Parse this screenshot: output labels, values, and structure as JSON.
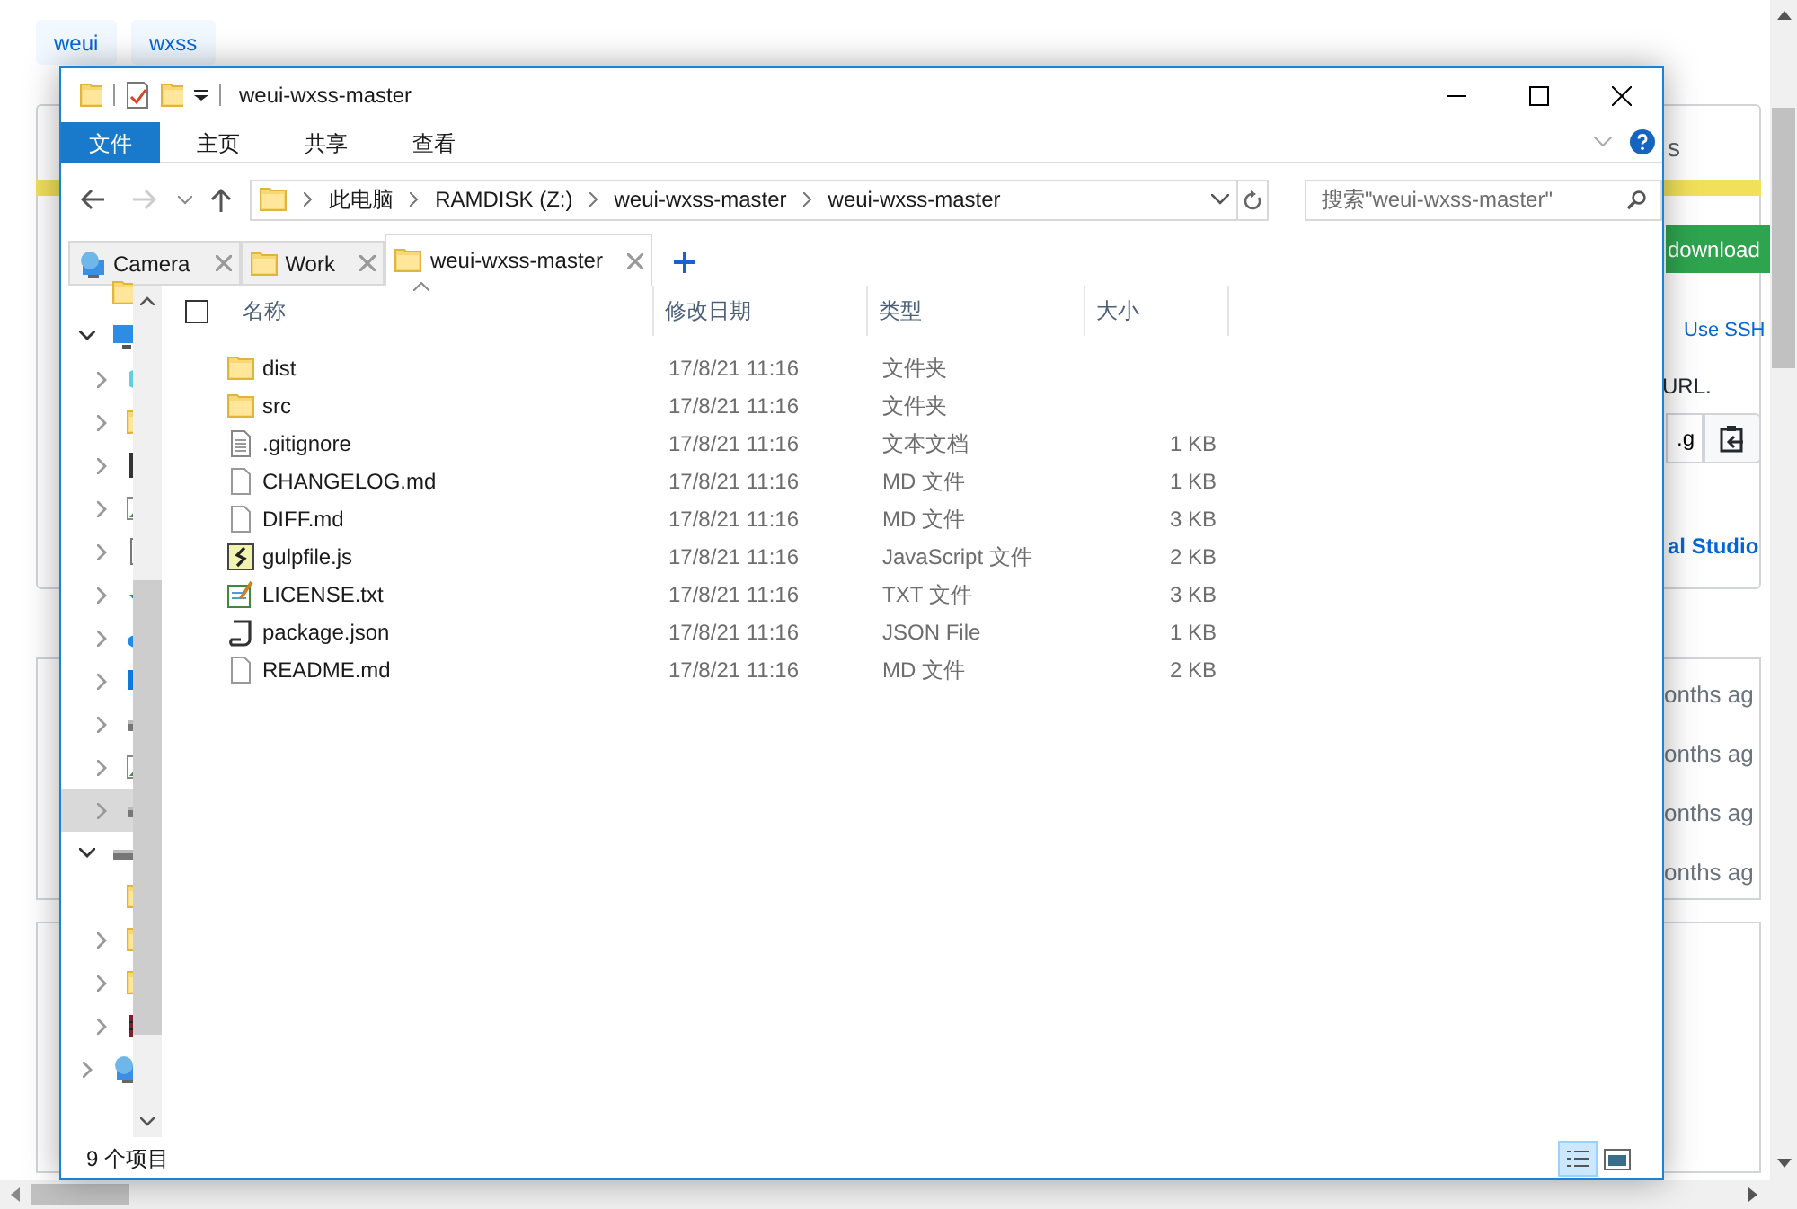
{
  "background_page": {
    "tags": [
      "weui",
      "wxss"
    ],
    "cut_text": "s",
    "download_button": "download",
    "ssh_link": "Use SSH",
    "hint": "URL.",
    "url_field": ".g",
    "studio_link": "al Studio",
    "commit_times": [
      "onths ag",
      "onths ag",
      "onths ag",
      "onths ag"
    ]
  },
  "window": {
    "title": "weui-wxss-master"
  },
  "ribbon_tabs": [
    {
      "label": "文件",
      "selected": true
    },
    {
      "label": "主页",
      "selected": false
    },
    {
      "label": "共享",
      "selected": false
    },
    {
      "label": "查看",
      "selected": false
    }
  ],
  "address": {
    "crumbs": [
      "此电脑",
      "RAMDISK (Z:)",
      "weui-wxss-master",
      "weui-wxss-master"
    ]
  },
  "search": {
    "placeholder": "搜索\"weui-wxss-master\""
  },
  "tabs": [
    {
      "label": "Camera",
      "kind": "network",
      "selected": false
    },
    {
      "label": "Work",
      "kind": "folder",
      "selected": false
    },
    {
      "label": "weui-wxss-master",
      "kind": "folder",
      "selected": true
    }
  ],
  "select_all": {
    "checked": false
  },
  "columns": [
    "名称",
    "修改日期",
    "类型",
    "大小"
  ],
  "files": [
    {
      "name": "dist",
      "kind": "folder",
      "modified": "17/8/21 11:16",
      "type": "文件夹"
    },
    {
      "name": "src",
      "kind": "folder",
      "modified": "17/8/21 11:16",
      "type": "文件夹"
    },
    {
      "name": ".gitignore",
      "kind": "text",
      "modified": "17/8/21 11:16",
      "type": "文本文档",
      "size": "1 KB"
    },
    {
      "name": "CHANGELOG.md",
      "kind": "blank",
      "modified": "17/8/21 11:16",
      "type": "MD 文件",
      "size": "1 KB"
    },
    {
      "name": "DIFF.md",
      "kind": "blank",
      "modified": "17/8/21 11:16",
      "type": "MD 文件",
      "size": "3 KB"
    },
    {
      "name": "gulpfile.js",
      "kind": "script",
      "modified": "17/8/21 11:16",
      "type": "JavaScript 文件",
      "size": "2 KB"
    },
    {
      "name": "LICENSE.txt",
      "kind": "notepad",
      "modified": "17/8/21 11:16",
      "type": "TXT 文件",
      "size": "3 KB"
    },
    {
      "name": "package.json",
      "kind": "json",
      "modified": "17/8/21 11:16",
      "type": "JSON File",
      "size": "1 KB"
    },
    {
      "name": "README.md",
      "kind": "blank",
      "modified": "17/8/21 11:16",
      "type": "MD 文件",
      "size": "2 KB"
    }
  ],
  "nav": [
    {
      "kind": "folder"
    },
    {
      "kind": "computer",
      "expanded": true,
      "children": [
        {
          "kind": "cube",
          "expanded": false
        },
        {
          "kind": "folder",
          "expanded": false
        },
        {
          "kind": "video",
          "expanded": false
        },
        {
          "kind": "image",
          "expanded": false
        },
        {
          "kind": "document",
          "expanded": false
        },
        {
          "kind": "download",
          "expanded": false
        },
        {
          "kind": "cloud",
          "expanded": false
        },
        {
          "kind": "desktop",
          "expanded": false
        },
        {
          "kind": "drive",
          "expanded": false
        },
        {
          "kind": "image",
          "expanded": false
        },
        {
          "kind": "drive",
          "expanded": false,
          "selected": true
        }
      ]
    },
    {
      "kind": "drive",
      "expanded": true,
      "children": [
        {
          "kind": "folder"
        },
        {
          "kind": "folder",
          "expanded": false
        },
        {
          "kind": "folder",
          "expanded": false
        },
        {
          "kind": "archive",
          "expanded": false
        }
      ]
    },
    {
      "kind": "network",
      "expanded": false
    }
  ],
  "status_bar": {
    "count": "9 个项目"
  },
  "view_buttons": [
    {
      "kind": "details",
      "selected": true
    },
    {
      "kind": "thumbnails",
      "selected": false
    }
  ]
}
